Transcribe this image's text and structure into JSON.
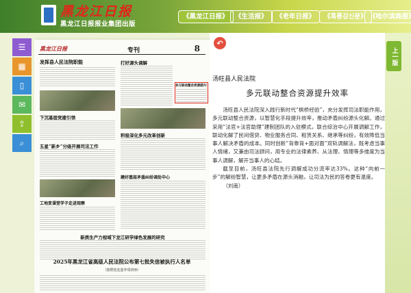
{
  "header": {
    "masthead": "黑龙江日报",
    "subtitle": "黑龙江日报报业集团出版",
    "tabs": [
      {
        "label": "《黑龙江日报》",
        "active": true
      },
      {
        "label": "《生活报》",
        "active": false
      },
      {
        "label": "《老年日报》",
        "active": false
      },
      {
        "label": "《흑룡강신문》",
        "active": false
      },
      {
        "label": "《哈尔滨商报》",
        "active": false
      }
    ]
  },
  "sidebar": {
    "buttons": [
      {
        "icon": "menu-icon",
        "glyph": "☰",
        "color": "#8e5bd1"
      },
      {
        "icon": "calendar-icon",
        "glyph": "▦",
        "color": "#e8952b"
      },
      {
        "icon": "phone-icon",
        "glyph": "▯",
        "color": "#3a8fd6"
      },
      {
        "icon": "chat-icon",
        "glyph": "✉",
        "color": "#5cb85c"
      },
      {
        "icon": "share-icon",
        "glyph": "⇪",
        "color": "#8fbf2c"
      },
      {
        "icon": "search-icon",
        "glyph": "⌕",
        "color": "#3a8fd6"
      }
    ]
  },
  "newspaper": {
    "logo": "黑龙江日报",
    "section": "专刊",
    "page": "8",
    "headlines": [
      "发挥县人民法院职能",
      "多元联动整合资源提升效率",
      "下沉基层党建引领",
      "打好源头调解",
      "五星”新乡”分级开展司法工作",
      "积极深化多元改革创新",
      "工地变课堂学子走进观察",
      "建好基层矛盾纠纷调处中心",
      "新质生产力视域下龙江研学绿色发展的研究"
    ],
    "bottom_title": "2025年黑龙江省高级人民法院公布第七批失信被执行人名单",
    "bottom_sub": "（按照姓名首字母排序）"
  },
  "article": {
    "source": "汤旺县人民法院",
    "title": "多元联动整合资源提升效率",
    "paragraphs": [
      "汤旺县人民法院深入践行新时代“枫桥经验”，充分发挥司法职能作用，多元联动整合资源，以智慧化手段提升效率，推动矛盾纠纷源头化解。通过采用“法官+法官助理”建制团队的入驻模式，联合综治中心开展调解工作，联动化解了民间借贷、物业服务合同、租赁关系、继承等纠纷，有效降低当事人解决矛盾的成本。同时创新“背靠背+面对面”双轨调解法，既考虑当事人情绪，又兼由司法顾问，用专业的法律素养、从法理、情理等多维度为当事人调解，解开当事人的心结。",
      "截至目前，汤旺县法院先行调解成功分流率达33%。这种“向前一步”的解纷智慧，让更多矛盾在源头消融，让司法为民的答卷更有温度。",
      "（刘南）"
    ]
  },
  "nav": {
    "prev_page": "上一版"
  }
}
